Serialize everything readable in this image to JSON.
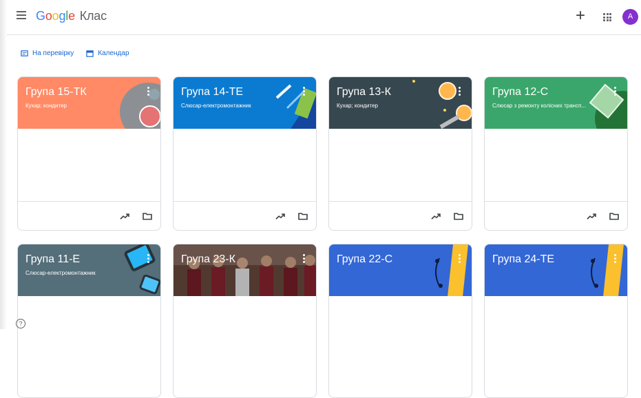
{
  "app": {
    "brand_letters": [
      "G",
      "o",
      "o",
      "g",
      "l",
      "e"
    ],
    "product": "Клас",
    "avatar_letter": "A",
    "add_label": "+"
  },
  "subnav": {
    "review": "На перевірку",
    "calendar": "Календар"
  },
  "classes": [
    {
      "title": "Група 15-ТК",
      "section": "Кухар; кондитер",
      "color": "#ff8a65"
    },
    {
      "title": "Група 14-ТЕ",
      "section": "Слюсар-електромонтажник",
      "color": "#0b7bd1"
    },
    {
      "title": "Група 13-К",
      "section": "Кухар; кондитер",
      "color": "#37474f"
    },
    {
      "title": "Група 12-С",
      "section": "Слюсар з ремонту колісних трансп...",
      "color": "#3aa66b"
    },
    {
      "title": "Група 11-Е",
      "section": "Слюсар-електромонтажник",
      "color": "#546e7a"
    },
    {
      "title": "Група 23-К",
      "section": "",
      "color": "#5d3a3a"
    },
    {
      "title": "Група 22-С",
      "section": "",
      "color": "#3367d6"
    },
    {
      "title": "Група 24-ТЕ",
      "section": "",
      "color": "#3367d6"
    }
  ],
  "help": "?"
}
